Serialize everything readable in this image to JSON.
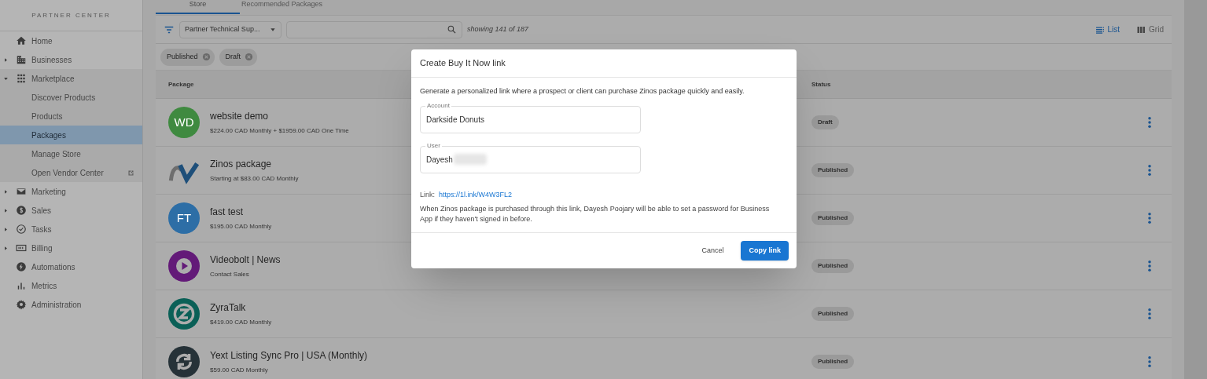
{
  "sidebar": {
    "title": "PARTNER CENTER",
    "items": [
      {
        "label": "Home"
      },
      {
        "label": "Businesses",
        "expanded": false
      },
      {
        "label": "Marketplace",
        "expanded": true,
        "children": [
          {
            "label": "Discover Products",
            "selected": false
          },
          {
            "label": "Products",
            "selected": false
          },
          {
            "label": "Packages",
            "selected": true
          },
          {
            "label": "Manage Store",
            "selected": false
          },
          {
            "label": "Open Vendor Center",
            "selected": false,
            "external": true
          }
        ]
      },
      {
        "label": "Marketing",
        "expanded": false
      },
      {
        "label": "Sales",
        "expanded": false
      },
      {
        "label": "Tasks",
        "expanded": false
      },
      {
        "label": "Billing",
        "expanded": false
      },
      {
        "label": "Automations"
      },
      {
        "label": "Metrics"
      },
      {
        "label": "Administration"
      }
    ]
  },
  "tabs": [
    {
      "label": "Store",
      "selected": true
    },
    {
      "label": "Recommended Packages",
      "selected": false
    }
  ],
  "toolbar": {
    "filter_value": "Partner Technical Sup...",
    "count": "showing 141 of 187",
    "views": [
      {
        "label": "List",
        "selected": true
      },
      {
        "label": "Grid",
        "selected": false
      }
    ]
  },
  "chips": [
    "Published",
    "Draft"
  ],
  "table": {
    "columns": [
      "Package",
      "Status"
    ],
    "rows": [
      {
        "kind": "initials",
        "initials": "WD",
        "color": "#3f8a40",
        "name": "website demo",
        "price": "$224.00 CAD Monthly + $1959.00 CAD One Time",
        "status": "Draft"
      },
      {
        "kind": "wave",
        "name": "Zinos package",
        "price": "Starting at $83.00 CAD Monthly",
        "status": "Published"
      },
      {
        "kind": "initials",
        "initials": "FT",
        "color": "#2d6ea6",
        "name": "fast test",
        "price": "$195.00 CAD Monthly",
        "status": "Published"
      },
      {
        "kind": "play",
        "name": "Videobolt | News",
        "price": "Contact Sales",
        "status": "Published"
      },
      {
        "kind": "chat",
        "name": "ZyraTalk",
        "price": "$419.00 CAD Monthly",
        "status": "Published"
      },
      {
        "kind": "sync",
        "name": "Yext Listing Sync Pro | USA (Monthly)",
        "price": "$59.00 CAD Monthly",
        "status": "Published"
      }
    ]
  },
  "dialog": {
    "title": "Create Buy It Now link",
    "description": "Generate a personalized link where a prospect or client can purchase Zinos package quickly and easily.",
    "fields": [
      {
        "label": "Account",
        "value": "Darkside Donuts",
        "redacted": false
      },
      {
        "label": "User",
        "value": "Dayesh",
        "redacted": true
      }
    ],
    "link_label": "Link:",
    "link": "https://1l.ink/W4W3FL2",
    "note": "When Zinos package is purchased through this link, Dayesh Poojary will be able to set a password for Business App if they haven't signed in before.",
    "buttons": [
      {
        "label": "Cancel",
        "kind": "text"
      },
      {
        "label": "Copy link",
        "kind": "primary"
      }
    ]
  }
}
